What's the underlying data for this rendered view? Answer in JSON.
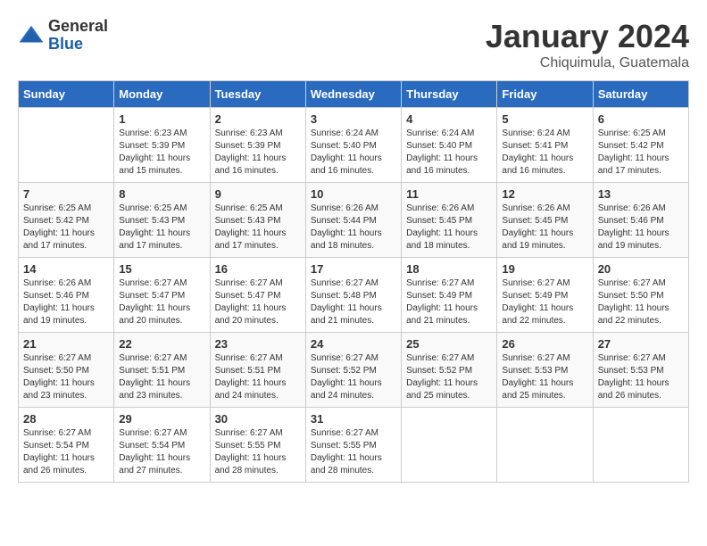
{
  "logo": {
    "general": "General",
    "blue": "Blue"
  },
  "title": "January 2024",
  "location": "Chiquimula, Guatemala",
  "days_of_week": [
    "Sunday",
    "Monday",
    "Tuesday",
    "Wednesday",
    "Thursday",
    "Friday",
    "Saturday"
  ],
  "weeks": [
    [
      {
        "num": "",
        "sunrise": "",
        "sunset": "",
        "daylight": ""
      },
      {
        "num": "1",
        "sunrise": "Sunrise: 6:23 AM",
        "sunset": "Sunset: 5:39 PM",
        "daylight": "Daylight: 11 hours and 15 minutes."
      },
      {
        "num": "2",
        "sunrise": "Sunrise: 6:23 AM",
        "sunset": "Sunset: 5:39 PM",
        "daylight": "Daylight: 11 hours and 16 minutes."
      },
      {
        "num": "3",
        "sunrise": "Sunrise: 6:24 AM",
        "sunset": "Sunset: 5:40 PM",
        "daylight": "Daylight: 11 hours and 16 minutes."
      },
      {
        "num": "4",
        "sunrise": "Sunrise: 6:24 AM",
        "sunset": "Sunset: 5:40 PM",
        "daylight": "Daylight: 11 hours and 16 minutes."
      },
      {
        "num": "5",
        "sunrise": "Sunrise: 6:24 AM",
        "sunset": "Sunset: 5:41 PM",
        "daylight": "Daylight: 11 hours and 16 minutes."
      },
      {
        "num": "6",
        "sunrise": "Sunrise: 6:25 AM",
        "sunset": "Sunset: 5:42 PM",
        "daylight": "Daylight: 11 hours and 17 minutes."
      }
    ],
    [
      {
        "num": "7",
        "sunrise": "Sunrise: 6:25 AM",
        "sunset": "Sunset: 5:42 PM",
        "daylight": "Daylight: 11 hours and 17 minutes."
      },
      {
        "num": "8",
        "sunrise": "Sunrise: 6:25 AM",
        "sunset": "Sunset: 5:43 PM",
        "daylight": "Daylight: 11 hours and 17 minutes."
      },
      {
        "num": "9",
        "sunrise": "Sunrise: 6:25 AM",
        "sunset": "Sunset: 5:43 PM",
        "daylight": "Daylight: 11 hours and 17 minutes."
      },
      {
        "num": "10",
        "sunrise": "Sunrise: 6:26 AM",
        "sunset": "Sunset: 5:44 PM",
        "daylight": "Daylight: 11 hours and 18 minutes."
      },
      {
        "num": "11",
        "sunrise": "Sunrise: 6:26 AM",
        "sunset": "Sunset: 5:45 PM",
        "daylight": "Daylight: 11 hours and 18 minutes."
      },
      {
        "num": "12",
        "sunrise": "Sunrise: 6:26 AM",
        "sunset": "Sunset: 5:45 PM",
        "daylight": "Daylight: 11 hours and 19 minutes."
      },
      {
        "num": "13",
        "sunrise": "Sunrise: 6:26 AM",
        "sunset": "Sunset: 5:46 PM",
        "daylight": "Daylight: 11 hours and 19 minutes."
      }
    ],
    [
      {
        "num": "14",
        "sunrise": "Sunrise: 6:26 AM",
        "sunset": "Sunset: 5:46 PM",
        "daylight": "Daylight: 11 hours and 19 minutes."
      },
      {
        "num": "15",
        "sunrise": "Sunrise: 6:27 AM",
        "sunset": "Sunset: 5:47 PM",
        "daylight": "Daylight: 11 hours and 20 minutes."
      },
      {
        "num": "16",
        "sunrise": "Sunrise: 6:27 AM",
        "sunset": "Sunset: 5:47 PM",
        "daylight": "Daylight: 11 hours and 20 minutes."
      },
      {
        "num": "17",
        "sunrise": "Sunrise: 6:27 AM",
        "sunset": "Sunset: 5:48 PM",
        "daylight": "Daylight: 11 hours and 21 minutes."
      },
      {
        "num": "18",
        "sunrise": "Sunrise: 6:27 AM",
        "sunset": "Sunset: 5:49 PM",
        "daylight": "Daylight: 11 hours and 21 minutes."
      },
      {
        "num": "19",
        "sunrise": "Sunrise: 6:27 AM",
        "sunset": "Sunset: 5:49 PM",
        "daylight": "Daylight: 11 hours and 22 minutes."
      },
      {
        "num": "20",
        "sunrise": "Sunrise: 6:27 AM",
        "sunset": "Sunset: 5:50 PM",
        "daylight": "Daylight: 11 hours and 22 minutes."
      }
    ],
    [
      {
        "num": "21",
        "sunrise": "Sunrise: 6:27 AM",
        "sunset": "Sunset: 5:50 PM",
        "daylight": "Daylight: 11 hours and 23 minutes."
      },
      {
        "num": "22",
        "sunrise": "Sunrise: 6:27 AM",
        "sunset": "Sunset: 5:51 PM",
        "daylight": "Daylight: 11 hours and 23 minutes."
      },
      {
        "num": "23",
        "sunrise": "Sunrise: 6:27 AM",
        "sunset": "Sunset: 5:51 PM",
        "daylight": "Daylight: 11 hours and 24 minutes."
      },
      {
        "num": "24",
        "sunrise": "Sunrise: 6:27 AM",
        "sunset": "Sunset: 5:52 PM",
        "daylight": "Daylight: 11 hours and 24 minutes."
      },
      {
        "num": "25",
        "sunrise": "Sunrise: 6:27 AM",
        "sunset": "Sunset: 5:52 PM",
        "daylight": "Daylight: 11 hours and 25 minutes."
      },
      {
        "num": "26",
        "sunrise": "Sunrise: 6:27 AM",
        "sunset": "Sunset: 5:53 PM",
        "daylight": "Daylight: 11 hours and 25 minutes."
      },
      {
        "num": "27",
        "sunrise": "Sunrise: 6:27 AM",
        "sunset": "Sunset: 5:53 PM",
        "daylight": "Daylight: 11 hours and 26 minutes."
      }
    ],
    [
      {
        "num": "28",
        "sunrise": "Sunrise: 6:27 AM",
        "sunset": "Sunset: 5:54 PM",
        "daylight": "Daylight: 11 hours and 26 minutes."
      },
      {
        "num": "29",
        "sunrise": "Sunrise: 6:27 AM",
        "sunset": "Sunset: 5:54 PM",
        "daylight": "Daylight: 11 hours and 27 minutes."
      },
      {
        "num": "30",
        "sunrise": "Sunrise: 6:27 AM",
        "sunset": "Sunset: 5:55 PM",
        "daylight": "Daylight: 11 hours and 28 minutes."
      },
      {
        "num": "31",
        "sunrise": "Sunrise: 6:27 AM",
        "sunset": "Sunset: 5:55 PM",
        "daylight": "Daylight: 11 hours and 28 minutes."
      },
      {
        "num": "",
        "sunrise": "",
        "sunset": "",
        "daylight": ""
      },
      {
        "num": "",
        "sunrise": "",
        "sunset": "",
        "daylight": ""
      },
      {
        "num": "",
        "sunrise": "",
        "sunset": "",
        "daylight": ""
      }
    ]
  ]
}
